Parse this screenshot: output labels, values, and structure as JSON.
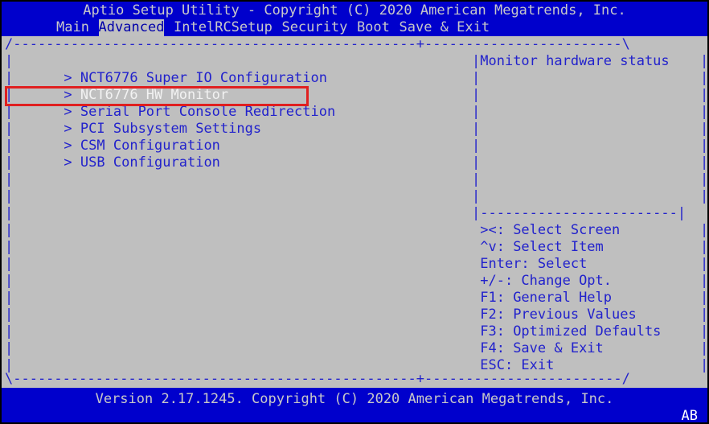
{
  "header": {
    "title": "Aptio Setup Utility - Copyright (C) 2020 American Megatrends, Inc.",
    "tabs": [
      {
        "label": "Main",
        "selected": false
      },
      {
        "label": "Advanced",
        "selected": true
      },
      {
        "label": "IntelRCSetup",
        "selected": false
      },
      {
        "label": "Security",
        "selected": false
      },
      {
        "label": "Boot",
        "selected": false
      },
      {
        "label": "Save & Exit",
        "selected": false
      }
    ]
  },
  "borders": {
    "top": "/-------------------------------------------------+------------------------\\",
    "bottom": "\\-------------------------------------------------+------------------------/",
    "help_separator": "|------------------------|",
    "vbar": "|"
  },
  "menu": {
    "items": [
      {
        "chevron": ">",
        "label": "NCT6776 Super IO Configuration",
        "selected": false,
        "highlighted": false
      },
      {
        "chevron": ">",
        "label": "NCT6776 HW Monitor",
        "selected": true,
        "highlighted": false
      },
      {
        "chevron": ">",
        "label": "Serial Port Console Redirection",
        "selected": false,
        "highlighted": true
      },
      {
        "chevron": ">",
        "label": "PCI Subsystem Settings",
        "selected": false,
        "highlighted": false
      },
      {
        "chevron": ">",
        "label": "CSM Configuration",
        "selected": false,
        "highlighted": false
      },
      {
        "chevron": ">",
        "label": "USB Configuration",
        "selected": false,
        "highlighted": false
      }
    ]
  },
  "help": {
    "description": "Monitor hardware status",
    "keys": [
      "><: Select Screen",
      "^v: Select Item",
      "Enter: Select",
      "+/-: Change Opt.",
      "F1: General Help",
      "F2: Previous Values",
      "F3: Optimized Defaults",
      "F4: Save & Exit",
      "ESC: Exit"
    ]
  },
  "footer": {
    "version": "Version 2.17.1245. Copyright (C) 2020 American Megatrends, Inc.",
    "build_tag": "AB"
  },
  "colors": {
    "banner_blue": "#0000cc",
    "body_gray": "#bfbfbf",
    "text_blue": "#2222cc",
    "banner_text": "#c8c8c8",
    "selected_tab_bg": "#c0c0c0",
    "selected_item_text": "#f2f2f2",
    "annotation_red": "#e02020"
  }
}
